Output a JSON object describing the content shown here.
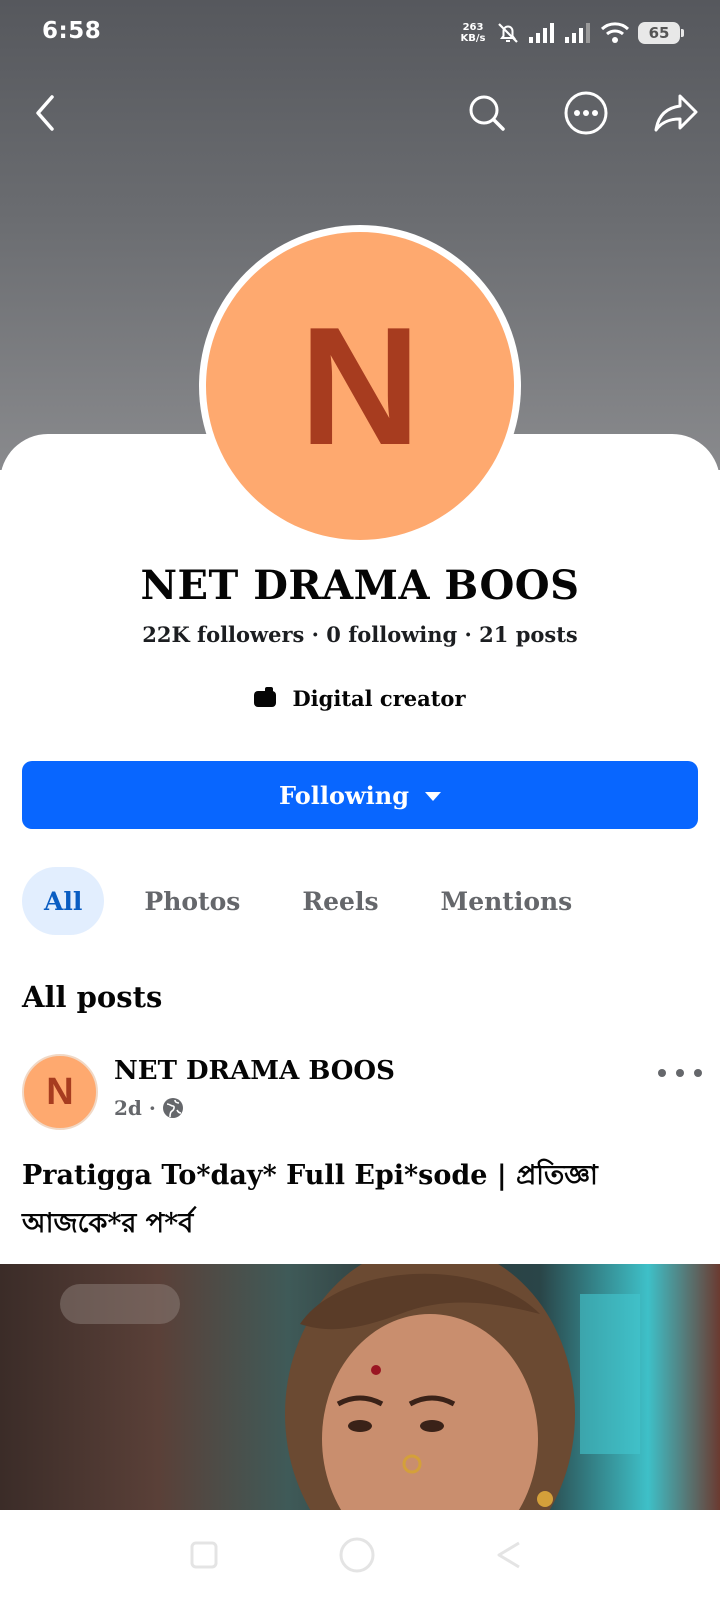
{
  "status_bar": {
    "time": "6:58",
    "net_speed_value": "263",
    "net_speed_unit": "KB/s",
    "battery": "65"
  },
  "profile": {
    "avatar_letter": "N",
    "name": "NET DRAMA BOOS",
    "stats": "22K followers · 0 following · 21 posts",
    "category": "Digital creator",
    "following_button": "Following"
  },
  "tabs": [
    {
      "label": "All",
      "active": true
    },
    {
      "label": "Photos",
      "active": false
    },
    {
      "label": "Reels",
      "active": false
    },
    {
      "label": "Mentions",
      "active": false
    }
  ],
  "section_title": "All posts",
  "post": {
    "avatar_letter": "N",
    "author": "NET DRAMA BOOS",
    "time": "2d ·",
    "text": "Pratigga To*day* Full Epi*sode | প্রতিজ্ঞা আজকে*র প*র্ব"
  },
  "colors": {
    "accent": "#0866ff",
    "avatar_bg": "#fea96f",
    "avatar_letter": "#a73c1f",
    "active_tab_bg": "#e2eefe"
  },
  "icons": {
    "back": "back-arrow-icon",
    "search": "search-icon",
    "more": "more-icon",
    "share": "share-icon",
    "category": "creator-icon",
    "audience": "globe-icon"
  }
}
